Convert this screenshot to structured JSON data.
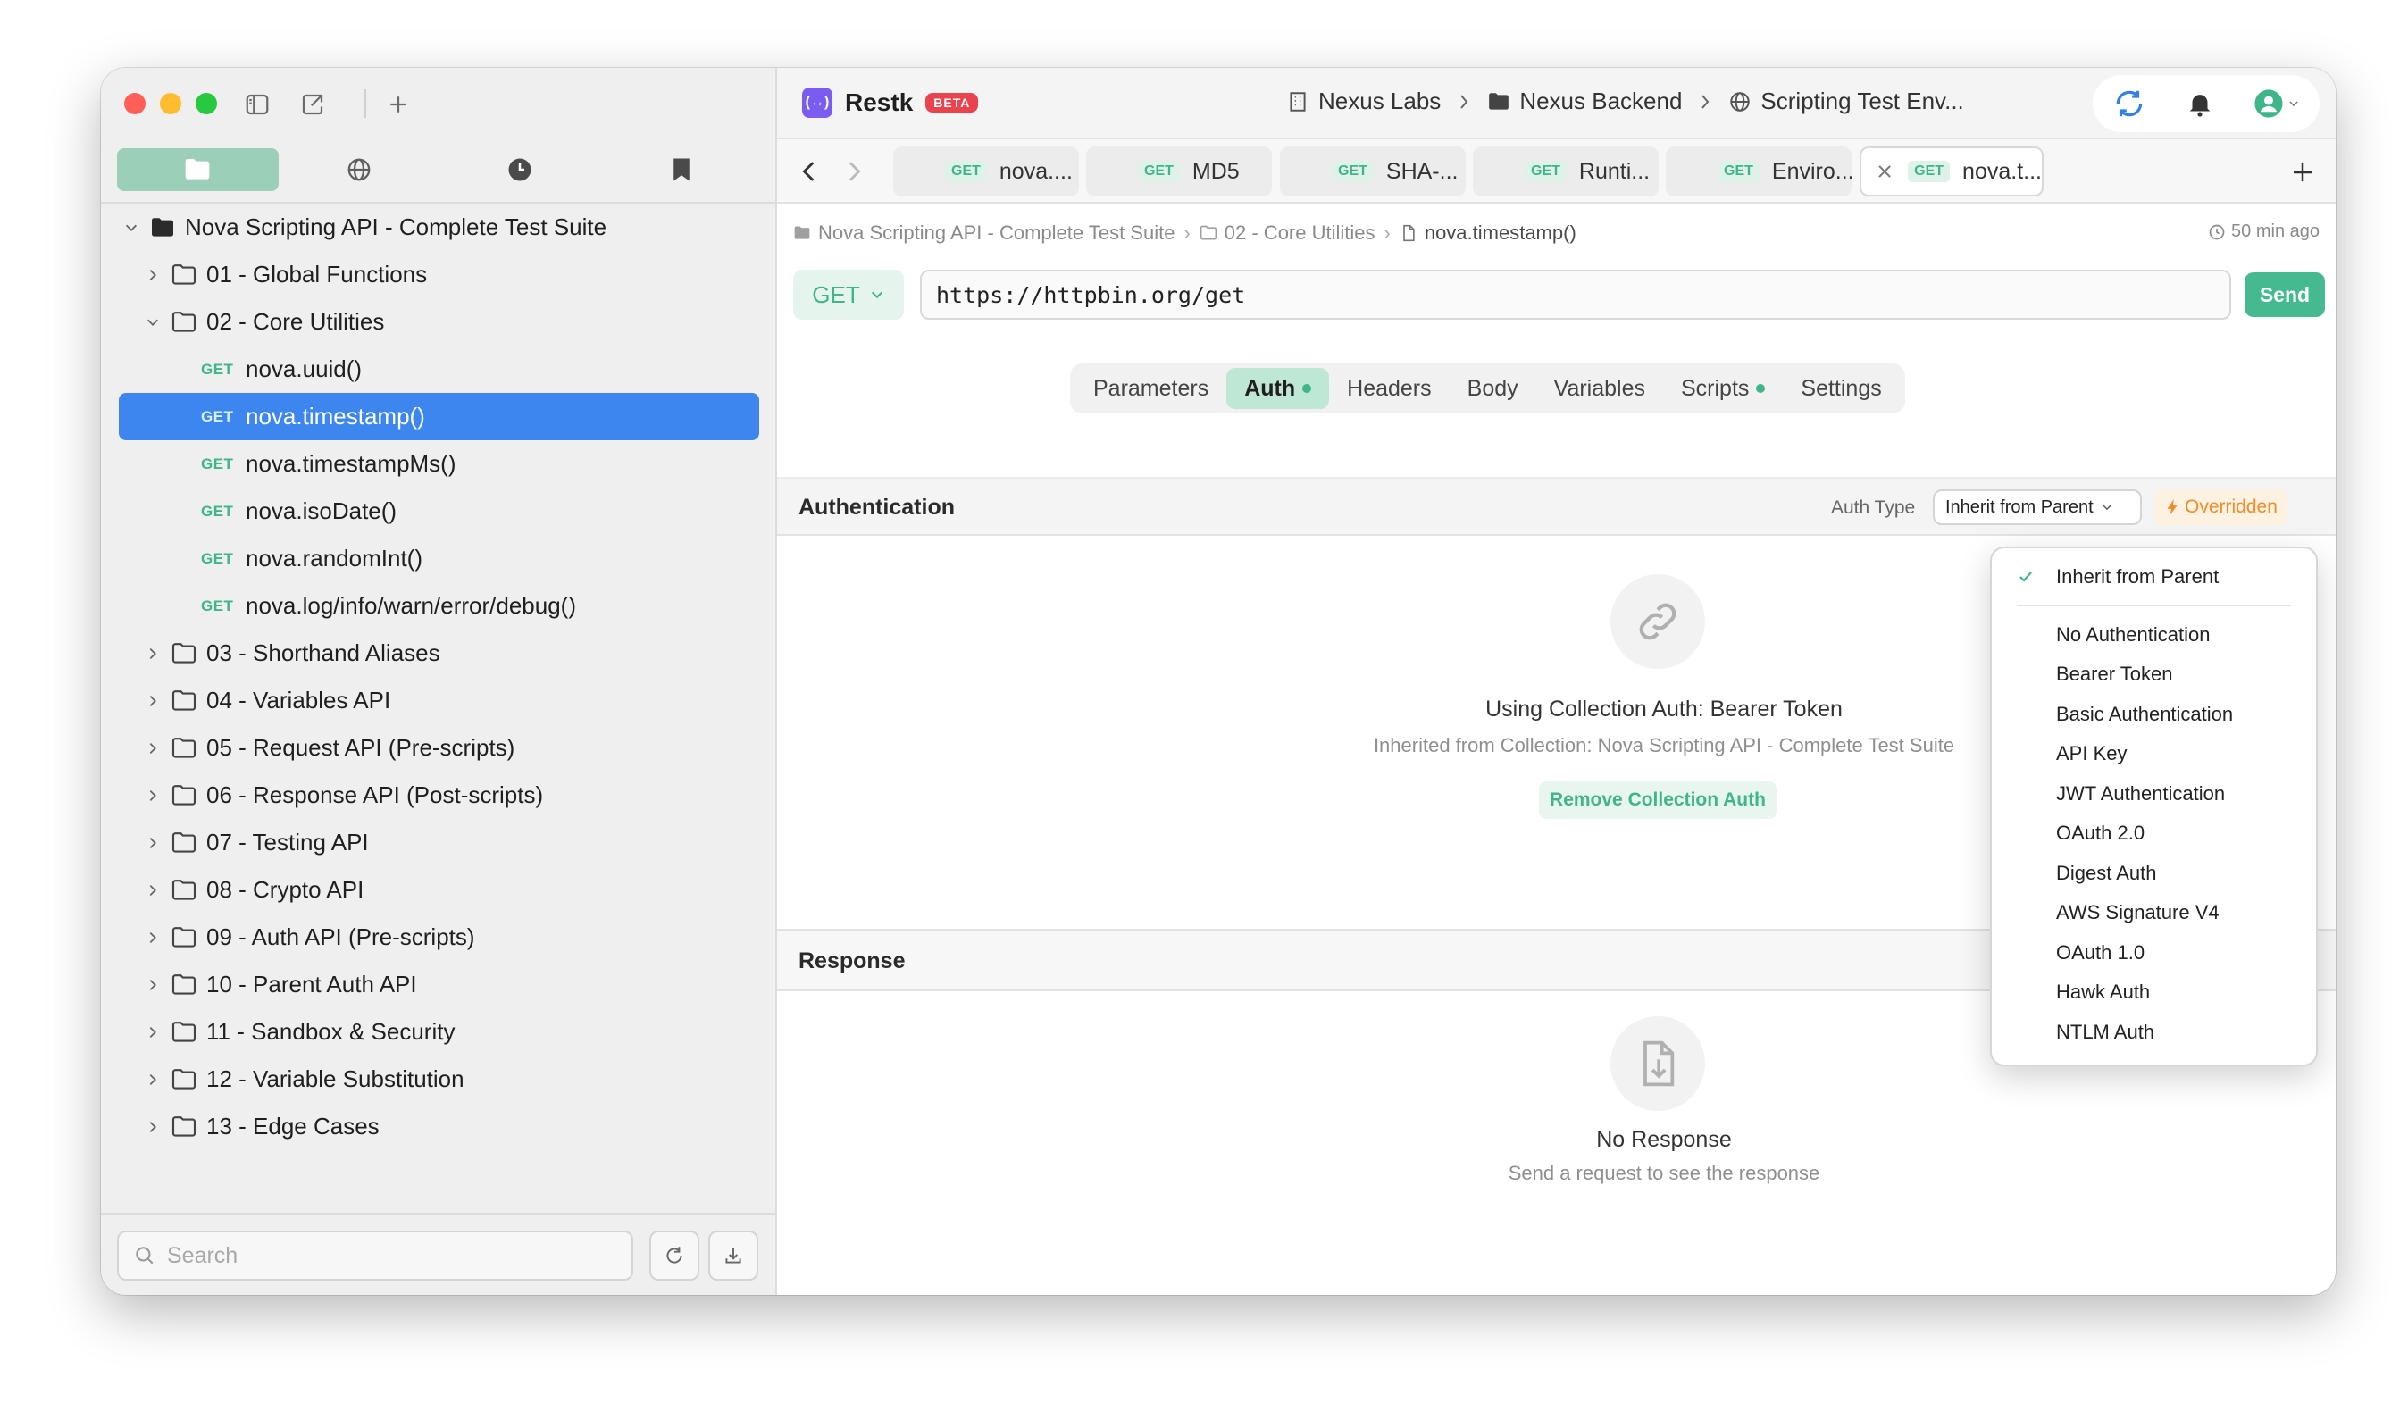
{
  "app": {
    "name": "Restk",
    "badge": "BETA"
  },
  "sidebar": {
    "collection_root": "Nova Scripting API - Complete Test Suite",
    "items": [
      {
        "label": "01 - Global Functions",
        "type": "folder",
        "expanded": false
      },
      {
        "label": "02 - Core Utilities",
        "type": "folder",
        "expanded": true
      },
      {
        "label": "nova.uuid()",
        "type": "request",
        "method": "GET"
      },
      {
        "label": "nova.timestamp()",
        "type": "request",
        "method": "GET",
        "selected": true
      },
      {
        "label": "nova.timestampMs()",
        "type": "request",
        "method": "GET"
      },
      {
        "label": "nova.isoDate()",
        "type": "request",
        "method": "GET"
      },
      {
        "label": "nova.randomInt()",
        "type": "request",
        "method": "GET"
      },
      {
        "label": "nova.log/info/warn/error/debug()",
        "type": "request",
        "method": "GET"
      },
      {
        "label": "03 - Shorthand Aliases",
        "type": "folder",
        "expanded": false
      },
      {
        "label": "04 - Variables API",
        "type": "folder",
        "expanded": false
      },
      {
        "label": "05 - Request API (Pre-scripts)",
        "type": "folder",
        "expanded": false
      },
      {
        "label": "06 - Response API (Post-scripts)",
        "type": "folder",
        "expanded": false
      },
      {
        "label": "07 - Testing API",
        "type": "folder",
        "expanded": false
      },
      {
        "label": "08 - Crypto API",
        "type": "folder",
        "expanded": false
      },
      {
        "label": "09 - Auth API (Pre-scripts)",
        "type": "folder",
        "expanded": false
      },
      {
        "label": "10 - Parent Auth API",
        "type": "folder",
        "expanded": false
      },
      {
        "label": "11 - Sandbox & Security",
        "type": "folder",
        "expanded": false
      },
      {
        "label": "12 - Variable Substitution",
        "type": "folder",
        "expanded": false
      },
      {
        "label": "13 - Edge Cases",
        "type": "folder",
        "expanded": false
      }
    ],
    "search_placeholder": "Search"
  },
  "topbar": {
    "workspace": "Nexus Labs",
    "project": "Nexus Backend",
    "environment": "Scripting Test Env..."
  },
  "tabs": [
    {
      "method": "GET",
      "label": "nova...."
    },
    {
      "method": "GET",
      "label": "MD5"
    },
    {
      "method": "GET",
      "label": "SHA-..."
    },
    {
      "method": "GET",
      "label": "Runti..."
    },
    {
      "method": "GET",
      "label": "Enviro..."
    },
    {
      "method": "GET",
      "label": "nova.t...",
      "active": true
    }
  ],
  "breadcrumb": {
    "collection": "Nova Scripting API - Complete Test Suite",
    "folder": "02 - Core Utilities",
    "request": "nova.timestamp()",
    "time_ago": "50 min ago"
  },
  "request": {
    "method": "GET",
    "url": "https://httpbin.org/get",
    "send_label": "Send"
  },
  "request_tabs": [
    {
      "label": "Parameters"
    },
    {
      "label": "Auth",
      "active": true,
      "dot": true
    },
    {
      "label": "Headers"
    },
    {
      "label": "Body"
    },
    {
      "label": "Variables"
    },
    {
      "label": "Scripts",
      "dot": true
    },
    {
      "label": "Settings"
    }
  ],
  "auth": {
    "title": "Authentication",
    "type_label": "Auth Type",
    "type_value": "Inherit from Parent",
    "overridden_label": "Overridden",
    "empty_title": "Using Collection Auth: Bearer Token",
    "empty_sub": "Inherited from Collection: Nova Scripting API - Complete Test Suite",
    "remove_label": "Remove Collection Auth"
  },
  "response": {
    "title": "Response",
    "empty_title": "No Response",
    "empty_sub": "Send a request to see the response"
  },
  "auth_dropdown": {
    "selected": "Inherit from Parent",
    "options": [
      "No Authentication",
      "Bearer Token",
      "Basic Authentication",
      "API Key",
      "JWT Authentication",
      "OAuth 2.0",
      "Digest Auth",
      "AWS Signature V4",
      "OAuth 1.0",
      "Hawk Auth",
      "NTLM Auth"
    ]
  },
  "colors": {
    "accent_green": "#3fb58a",
    "selection_blue": "#3d86f0",
    "brand_purple": "#7b5cf0",
    "beta_red": "#e9434d",
    "overridden_orange": "#f28c28"
  }
}
